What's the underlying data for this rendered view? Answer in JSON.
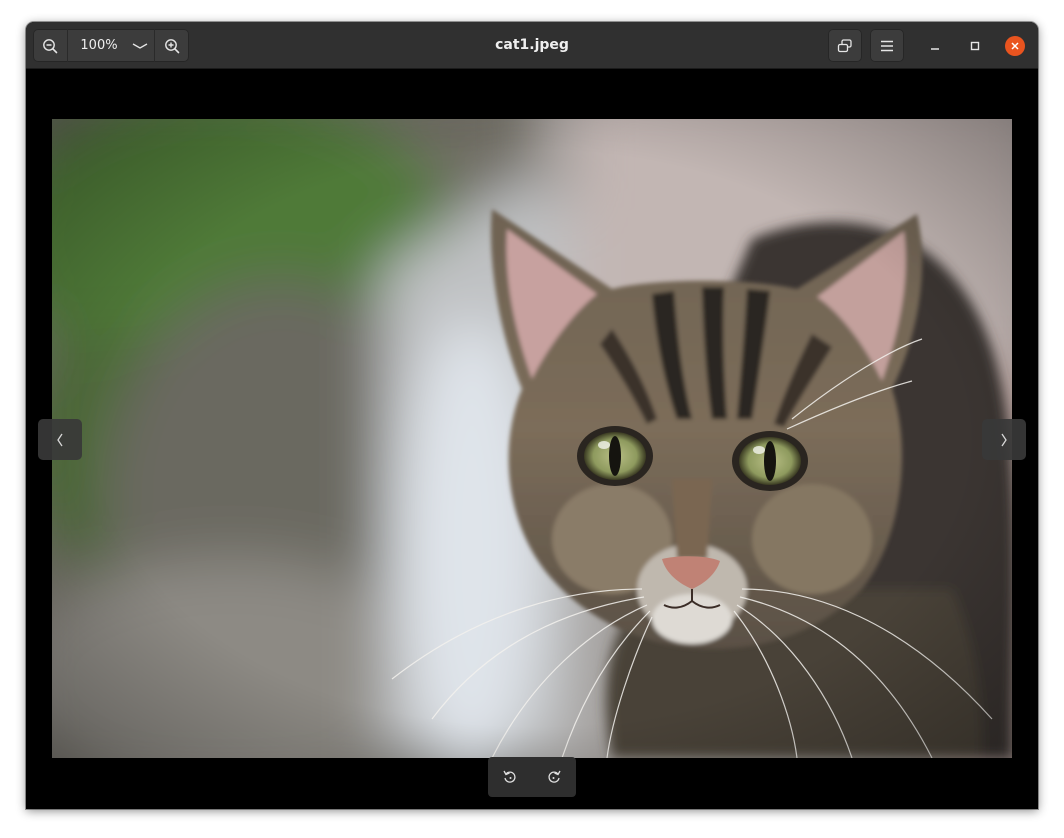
{
  "window": {
    "title": "cat1.jpeg"
  },
  "toolbar": {
    "zoom_level": "100%",
    "zoom_out_icon": "zoom-out-icon",
    "zoom_in_icon": "zoom-in-icon",
    "zoom_menu_icon": "chevron-down-icon",
    "fullscreen_icon": "restore-window-icon",
    "menu_icon": "hamburger-menu-icon"
  },
  "window_controls": {
    "minimize_icon": "minimize-icon",
    "maximize_icon": "maximize-icon",
    "close_icon": "close-icon",
    "close_color": "#e9541f"
  },
  "navigation": {
    "previous_icon": "chevron-left-icon",
    "next_icon": "chevron-right-icon"
  },
  "rotate": {
    "rotate_left_icon": "rotate-left-icon",
    "rotate_right_icon": "rotate-right-icon"
  },
  "colors": {
    "headerbar": "#303030",
    "viewer_background": "#000000"
  }
}
